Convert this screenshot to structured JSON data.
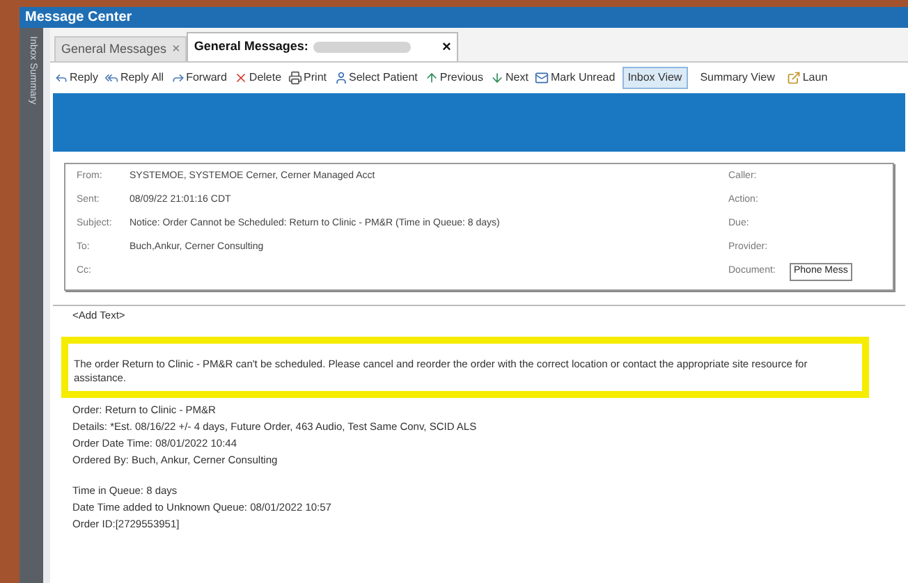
{
  "window": {
    "title": "Message Center"
  },
  "sidebar": {
    "label": "Inbox Summary"
  },
  "tabs": [
    {
      "label": "General Messages",
      "close": "×",
      "selected": false
    },
    {
      "label": "General Messages:",
      "close": "×",
      "selected": true
    }
  ],
  "toolbar": [
    {
      "kind": "action",
      "label": "Reply"
    },
    {
      "kind": "action",
      "label": "Reply All"
    },
    {
      "kind": "action",
      "label": "Forward"
    },
    {
      "kind": "action",
      "label": "Delete"
    },
    {
      "kind": "action",
      "label": "Print"
    },
    {
      "kind": "action",
      "label": "Select Patient"
    },
    {
      "kind": "action",
      "label": "Previous"
    },
    {
      "kind": "action",
      "label": "Next"
    },
    {
      "kind": "action",
      "label": "Mark Unread"
    },
    {
      "kind": "view",
      "label": "Inbox View",
      "selected": true
    },
    {
      "kind": "view",
      "label": "Summary View",
      "selected": false
    },
    {
      "kind": "action",
      "label": "Laun"
    }
  ],
  "header": {
    "left": [
      {
        "label": "From:",
        "value": "SYSTEMOE, SYSTEMOE Cerner, Cerner Managed Acct"
      },
      {
        "label": "Sent:",
        "value": "08/09/22 21:01:16 CDT"
      },
      {
        "label": "Subject:",
        "value": "Notice: Order Cannot be Scheduled: Return to Clinic - PM&R (Time in Queue: 8 days)"
      },
      {
        "label": "To:",
        "value": "Buch,Ankur, Cerner Consulting"
      },
      {
        "label": "Cc:"
      }
    ],
    "right": [
      {
        "label": "Caller:"
      },
      {
        "label": "Action:"
      },
      {
        "label": "Due:"
      },
      {
        "label": "Provider:"
      },
      {
        "label": "Document:",
        "select": "Phone Mess"
      }
    ]
  },
  "body": {
    "add_text": "<Add Text>",
    "highlighted": "The order Return to Clinic - PM&R can't be scheduled.  Please cancel and reorder the order with the correct location or contact the appropriate site resource for assistance.",
    "details": [
      "Order: Return to Clinic - PM&R",
      "Details: *Est. 08/16/22 +/- 4 days, Future Order, 463 Audio, Test Same Conv, SCID ALS",
      "Order Date Time:  08/01/2022 10:44",
      "Ordered By: Buch, Ankur, Cerner Consulting"
    ],
    "queue": [
      "Time in Queue:  8 days",
      "Date Time added to Unknown Queue:  08/01/2022 10:57",
      "Order ID:[2729553951]"
    ]
  }
}
